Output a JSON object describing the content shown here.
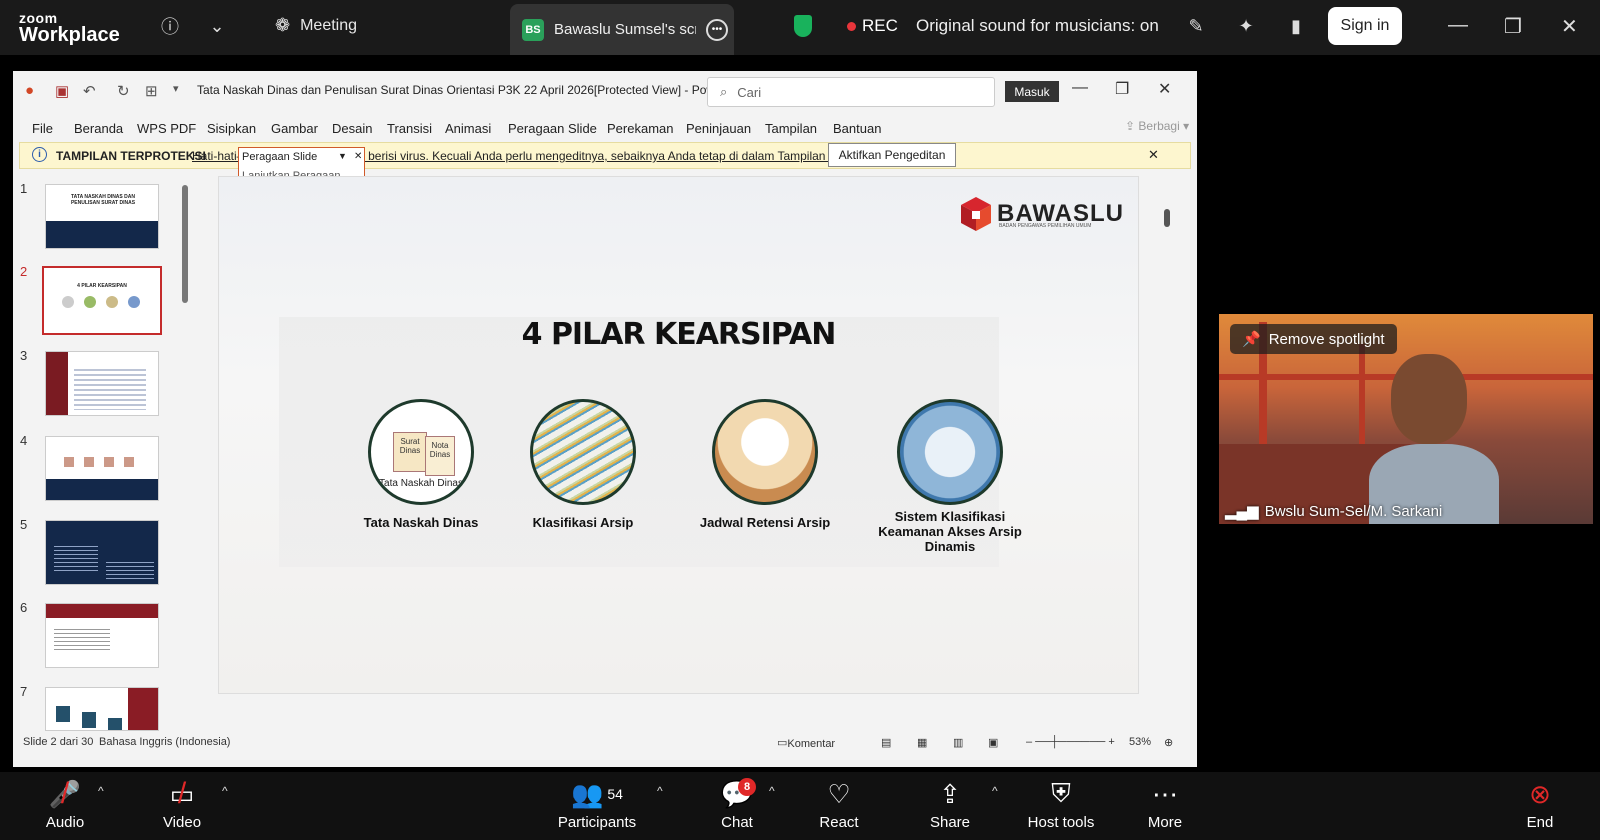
{
  "app": {
    "logo_top": "zoom",
    "logo_bottom": "Workplace"
  },
  "topbar": {
    "meeting_label": "Meeting",
    "share_tab_initials": "BS",
    "share_tab_label": "Bawaslu Sumsel's scre",
    "rec_label": "REC",
    "original_sound": "Original sound for musicians: on",
    "signin_label": "Sign in"
  },
  "ppt": {
    "doc_title": "Tata Naskah Dinas dan Penulisan Surat Dinas Orientasi P3K 22 April 2026[Protected View]  -  Powe...",
    "search_placeholder": "Cari",
    "masuk_label": "Masuk",
    "menu": [
      "File",
      "Beranda",
      "WPS PDF",
      "Sisipkan",
      "Gambar",
      "Desain",
      "Transisi",
      "Animasi",
      "Peragaan Slide",
      "Perekaman",
      "Peninjauan",
      "Tampilan",
      "Bantuan"
    ],
    "berbagi": "Berbagi",
    "protected_heading": "TAMPILAN TERPROTEKSI",
    "protected_warning": "Hati-hati—file dari Internet dapat berisi virus. Kecuali Anda perlu mengeditnya, sebaiknya Anda tetap di dalam Tampilan Terproteksi.",
    "enable_editing": "Aktifkan Pengeditan",
    "popup_title": "Peragaan Slide",
    "popup_item": "Lanjutkan Peragaan Slide",
    "slide_numbers": [
      "1",
      "2",
      "3",
      "4",
      "5",
      "6",
      "7"
    ],
    "thumb1_title": "TATA NASKAH DINAS DAN PENULISAN SURAT DINAS",
    "thumb2_title": "4 PILAR KEARSIPAN",
    "status_slide": "Slide 2 dari 30",
    "status_lang": "Bahasa Inggris (Indonesia)",
    "status_comment": "Komentar",
    "zoom_level": "53%"
  },
  "slide": {
    "brand": "BAWASLU",
    "brand_sub": "BADAN PENGAWAS PEMILIHAN UMUM",
    "title": "4 PILAR KEARSIPAN",
    "pillars": [
      {
        "label": "Tata Naskah Dinas",
        "inner1": "Surat Dinas",
        "inner2": "Nota Dinas",
        "inner3": "Tata Naskah Dinas"
      },
      {
        "label": "Klasifikasi Arsip"
      },
      {
        "label": "Jadwal Retensi Arsip"
      },
      {
        "label": "Sistem Klasifikasi Keamanan Akses Arsip Dinamis"
      }
    ]
  },
  "video": {
    "spotlight_label": "Remove spotlight",
    "participant_name": "Bwslu Sum-Sel/M. Sarkani"
  },
  "bottombar": {
    "audio": "Audio",
    "video": "Video",
    "participants": "Participants",
    "participants_count": "54",
    "chat": "Chat",
    "chat_badge": "8",
    "react": "React",
    "share": "Share",
    "host_tools": "Host tools",
    "more": "More",
    "end": "End"
  },
  "colors": {
    "accent_green": "#2aa05a",
    "rec_red": "#e8353b",
    "end_red": "#e02828",
    "slide_selection": "#c42b2b"
  }
}
